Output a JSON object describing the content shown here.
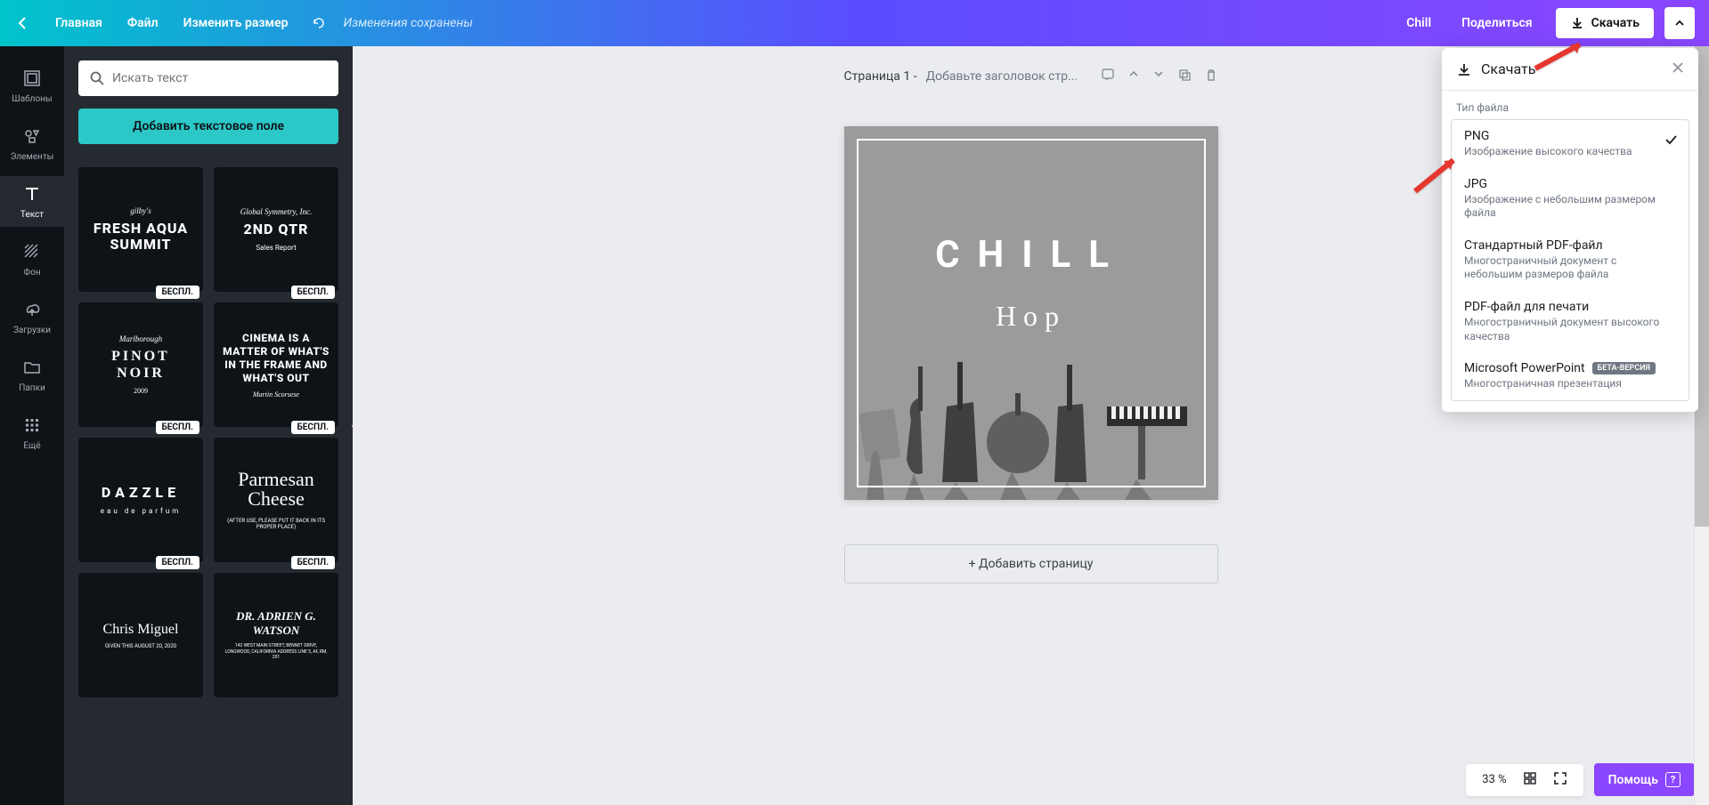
{
  "topbar": {
    "home": "Главная",
    "file": "Файл",
    "resize": "Изменить размер",
    "saved": "Изменения сохранены",
    "title": "Chill",
    "share": "Поделиться",
    "download": "Скачать"
  },
  "rail": [
    {
      "label": "Шаблоны"
    },
    {
      "label": "Элементы"
    },
    {
      "label": "Текст"
    },
    {
      "label": "Фон"
    },
    {
      "label": "Загрузки"
    },
    {
      "label": "Папки"
    },
    {
      "label": "Ещё"
    }
  ],
  "panel": {
    "search_placeholder": "Искать текст",
    "add_text": "Добавить текстовое поле",
    "badge": "БЕСПЛ.",
    "templates": [
      {
        "sub1": "gilby's",
        "main": "FRESH AQUA SUMMIT"
      },
      {
        "sub1": "Global Symmetry, Inc.",
        "main": "2ND QTR",
        "sub2": "Sales Report"
      },
      {
        "sub1": "Marlborough",
        "main": "PINOT NOIR",
        "sub2": "2009"
      },
      {
        "cinema": "CINEMA IS A MATTER OF WHAT'S IN THE FRAME AND WHAT'S OUT",
        "sub2": "Martin Scorsese"
      },
      {
        "main": "DAZZLE",
        "sub2": "eau de parfum"
      },
      {
        "script": "Parmesan Cheese",
        "sub2": "(AFTER USE, PLEASE PUT IT BACK IN ITS PROPER PLACE)"
      },
      {
        "serif": "Chris Miguel",
        "sub2": "GIVEN THIS AUGUST 20, 2020"
      },
      {
        "serif": "DR. ADRIEN G. WATSON",
        "sub2": "142 WEST MAIN STREET, BENNET DRIVE, LONGWOOD, CALIFORNIA ADDRESS LINE 5, AF, RM, 201"
      }
    ]
  },
  "page": {
    "label": "Страница 1 - ",
    "placeholder": "Добавьте заголовок стр...",
    "design_title": "CHILL",
    "design_sub": "Hop",
    "add_page": "+ Добавить страницу"
  },
  "dropdown": {
    "title": "Скачать",
    "filetype_label": "Тип файла",
    "items": [
      {
        "fmt": "PNG",
        "desc": "Изображение высокого качества",
        "selected": true
      },
      {
        "fmt": "JPG",
        "desc": "Изображение с небольшим размером файла"
      },
      {
        "fmt": "Стандартный PDF-файл",
        "desc": "Многостраничный документ с небольшим размеров файла"
      },
      {
        "fmt": "PDF-файл для печати",
        "desc": "Многостраничный документ высокого качества"
      },
      {
        "fmt": "Microsoft PowerPoint",
        "desc": "Многостраничная презентация",
        "beta": "БЕТА-ВЕРСИЯ"
      }
    ]
  },
  "bottom": {
    "zoom": "33 %",
    "help": "Помощь"
  }
}
